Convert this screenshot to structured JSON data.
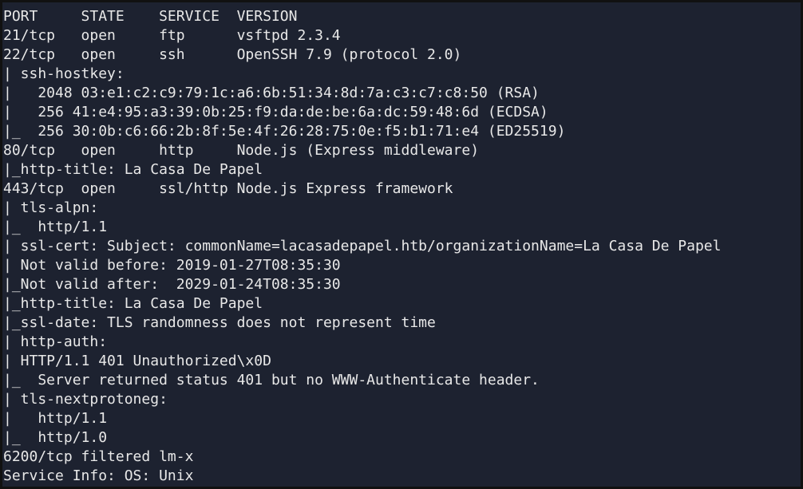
{
  "terminal": {
    "background": "#1d2230",
    "foreground": "#e8e8e8",
    "lines": [
      "PORT     STATE    SERVICE  VERSION",
      "21/tcp   open     ftp      vsftpd 2.3.4",
      "22/tcp   open     ssh      OpenSSH 7.9 (protocol 2.0)",
      "| ssh-hostkey:",
      "|   2048 03:e1:c2:c9:79:1c:a6:6b:51:34:8d:7a:c3:c7:c8:50 (RSA)",
      "|   256 41:e4:95:a3:39:0b:25:f9:da:de:be:6a:dc:59:48:6d (ECDSA)",
      "|_  256 30:0b:c6:66:2b:8f:5e:4f:26:28:75:0e:f5:b1:71:e4 (ED25519)",
      "80/tcp   open     http     Node.js (Express middleware)",
      "|_http-title: La Casa De Papel",
      "443/tcp  open     ssl/http Node.js Express framework",
      "| tls-alpn:",
      "|_  http/1.1",
      "| ssl-cert: Subject: commonName=lacasadepapel.htb/organizationName=La Casa De Papel",
      "| Not valid before: 2019-01-27T08:35:30",
      "|_Not valid after:  2029-01-24T08:35:30",
      "|_http-title: La Casa De Papel",
      "|_ssl-date: TLS randomness does not represent time",
      "| http-auth:",
      "| HTTP/1.1 401 Unauthorized\\x0D",
      "|_  Server returned status 401 but no WWW-Authenticate header.",
      "| tls-nextprotoneg:",
      "|   http/1.1",
      "|_  http/1.0",
      "6200/tcp filtered lm-x",
      "Service Info: OS: Unix"
    ]
  }
}
